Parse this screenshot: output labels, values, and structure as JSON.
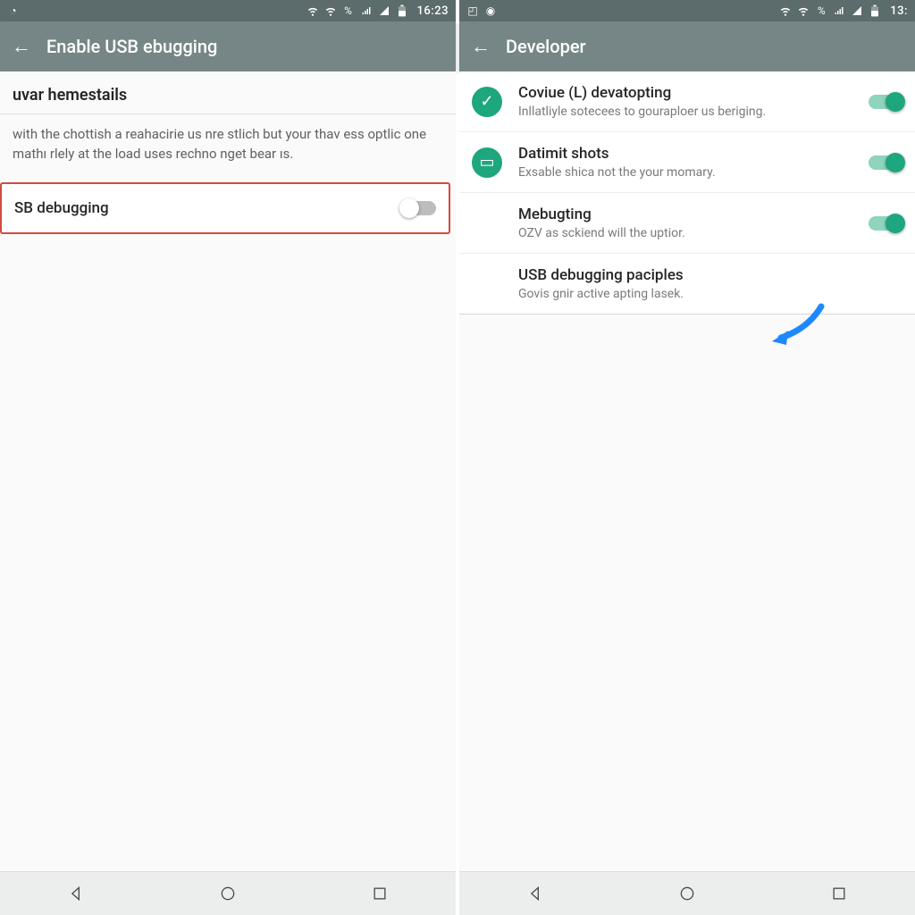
{
  "left": {
    "status": {
      "time": "16:23"
    },
    "appbar": {
      "title": "Enable USB ebugging"
    },
    "section_header": "uvar hemestails",
    "description": "with the chottish a reahacirie us nre stlich but your thav ess optlic one mathı rlely at the load uses rechno nget bear ıs.",
    "usb_row_label": "SB debugging"
  },
  "right": {
    "status": {
      "time": "13:"
    },
    "appbar": {
      "title": "Developer"
    },
    "rows": [
      {
        "title": "Coviue (L) devatopting",
        "sub": "Inllatliyle sotecees to gouraploer us beriging.",
        "icon": "check"
      },
      {
        "title": "Datimit shots",
        "sub": "Exsable shica not the your momary.",
        "icon": "card"
      },
      {
        "title": "Mebugting",
        "sub": "OZV as sckiend will the uptior.",
        "icon": ""
      },
      {
        "title": "USB debugging paciples",
        "sub": "Govis gnir active apting lasek.",
        "icon": ""
      }
    ]
  }
}
